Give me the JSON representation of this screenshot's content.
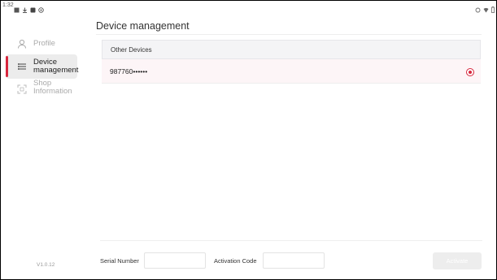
{
  "status_bar": {
    "time": "1:32"
  },
  "sidebar": {
    "items": [
      {
        "label": "Profile",
        "icon": "person-icon",
        "active": false
      },
      {
        "label": "Device management",
        "icon": "list-icon",
        "active": true
      },
      {
        "label": "Shop Information",
        "icon": "scan-icon",
        "active": false
      }
    ],
    "version": "V1.0.12"
  },
  "main": {
    "title": "Device management",
    "table": {
      "header": "Other Devices",
      "rows": [
        {
          "device": "987760••••••",
          "selected": true
        }
      ]
    },
    "form": {
      "serial_label": "Serial Number",
      "serial_value": "",
      "activation_label": "Activation Code",
      "activation_value": "",
      "activate_label": "Activate"
    }
  },
  "colors": {
    "accent": "#d7263d",
    "row_highlight": "#fdf5f7",
    "header_bg": "#f4f4f6"
  }
}
